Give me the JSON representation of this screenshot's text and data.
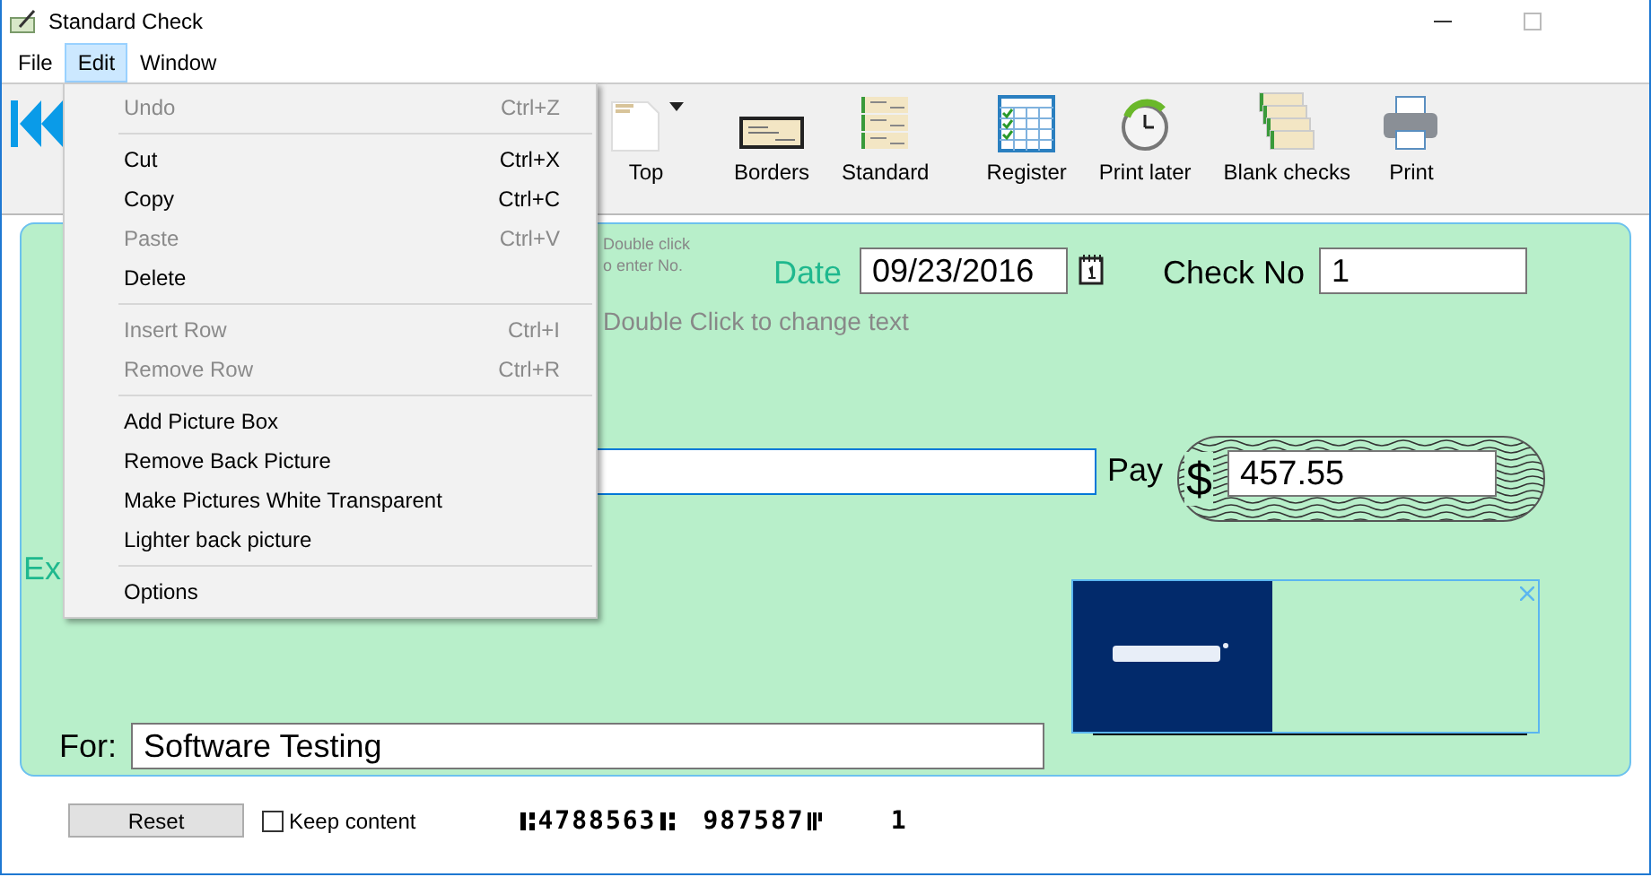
{
  "window": {
    "title": "Standard Check"
  },
  "menu_bar": [
    {
      "label": "File",
      "selected": false
    },
    {
      "label": "Edit",
      "selected": true
    },
    {
      "label": "Window",
      "selected": false
    }
  ],
  "edit_menu": [
    {
      "kind": "item",
      "label": "Undo",
      "shortcut": "Ctrl+Z",
      "disabled": true
    },
    {
      "kind": "separator"
    },
    {
      "kind": "item",
      "label": "Cut",
      "shortcut": "Ctrl+X",
      "disabled": false
    },
    {
      "kind": "item",
      "label": "Copy",
      "shortcut": "Ctrl+C",
      "disabled": false
    },
    {
      "kind": "item",
      "label": "Paste",
      "shortcut": "Ctrl+V",
      "disabled": true
    },
    {
      "kind": "item",
      "label": "Delete",
      "disabled": false
    },
    {
      "kind": "separator"
    },
    {
      "kind": "item",
      "label": "Insert Row",
      "shortcut": "Ctrl+I",
      "disabled": true
    },
    {
      "kind": "item",
      "label": "Remove Row",
      "shortcut": "Ctrl+R",
      "disabled": true
    },
    {
      "kind": "separator"
    },
    {
      "kind": "item",
      "label": "Add Picture Box",
      "disabled": false
    },
    {
      "kind": "item",
      "label": "Remove Back Picture",
      "disabled": false
    },
    {
      "kind": "item",
      "label": "Make Pictures White Transparent",
      "disabled": false
    },
    {
      "kind": "item",
      "label": "Lighter back picture",
      "disabled": false
    },
    {
      "kind": "separator"
    },
    {
      "kind": "item",
      "label": "Options",
      "disabled": false
    }
  ],
  "toolbar": [
    {
      "kind": "page",
      "label": "Top",
      "dropdown": true
    },
    {
      "kind": "borders",
      "label": "Borders",
      "dropdown": false
    },
    {
      "kind": "standard",
      "label": "Standard",
      "dropdown": false
    },
    {
      "kind": "register",
      "label": "Register",
      "dropdown": false
    },
    {
      "kind": "clock",
      "label": "Print later",
      "dropdown": false
    },
    {
      "kind": "stack",
      "label": "Blank checks",
      "dropdown": false
    },
    {
      "kind": "printer",
      "label": "Print",
      "dropdown": false
    }
  ],
  "check": {
    "number_hint": [
      "Double click",
      "o enter No."
    ],
    "date_label": "Date",
    "date": "09/23/2016",
    "check_no_label": "Check No",
    "check_no": "1",
    "text_hint": "Double Click to change text",
    "pay_label": "Pay",
    "currency": "$",
    "amount": "457.55",
    "side_label": "Ex",
    "picture_box": {
      "kind": "picture"
    },
    "for_label": "For:",
    "memo": "Software Testing"
  },
  "bottom": {
    "reset": "Reset",
    "keep_content": {
      "label": "Keep content",
      "checked": false
    },
    "micr": [
      "4788563",
      "987587",
      "1"
    ]
  }
}
